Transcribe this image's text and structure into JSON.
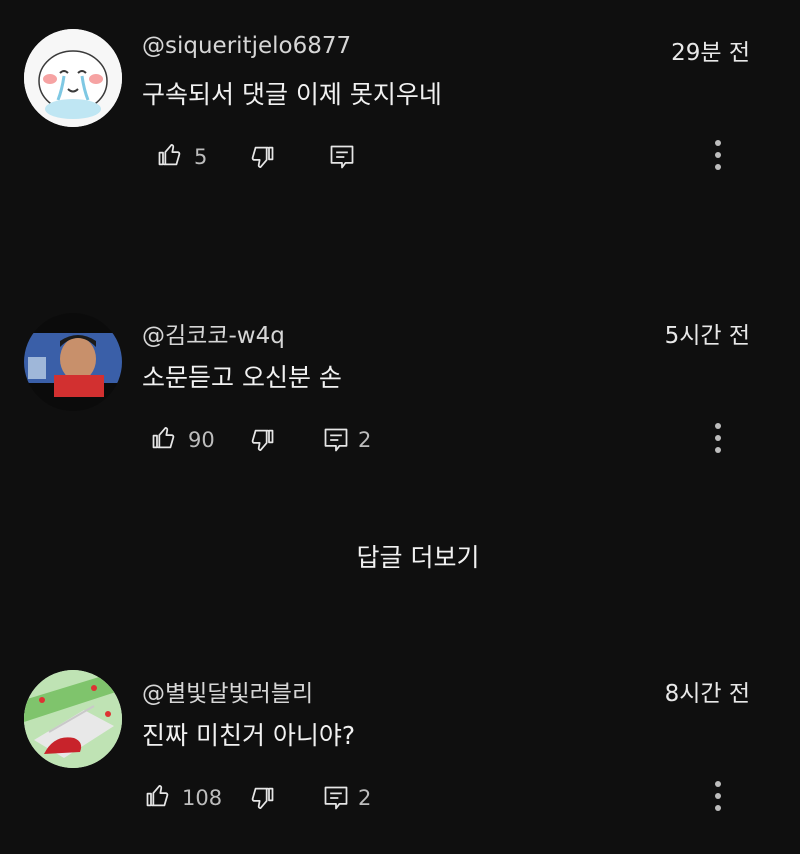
{
  "comments": [
    {
      "handle": "@siqueritjelo6877",
      "time": "29분 전",
      "text": "구속되서 댓글 이제 못지우네",
      "likes": "5",
      "replies": ""
    },
    {
      "handle": "@김코코-w4q",
      "time": "5시간 전",
      "text": "소문듣고 오신분 손",
      "likes": "90",
      "replies": "2"
    },
    {
      "handle": "@별빛달빛러블리",
      "time": "8시간 전",
      "text": "진짜 미친거 아니야?",
      "likes": "108",
      "replies": "2"
    }
  ],
  "show_replies_label": "답글 더보기",
  "icons": {
    "like": "thumbs-up-icon",
    "dislike": "thumbs-down-icon",
    "reply": "reply-icon",
    "more": "more-vert-icon"
  },
  "colors": {
    "background": "#0f0f0f",
    "text": "#f1f1f1",
    "secondary": "#bdbdbd"
  }
}
